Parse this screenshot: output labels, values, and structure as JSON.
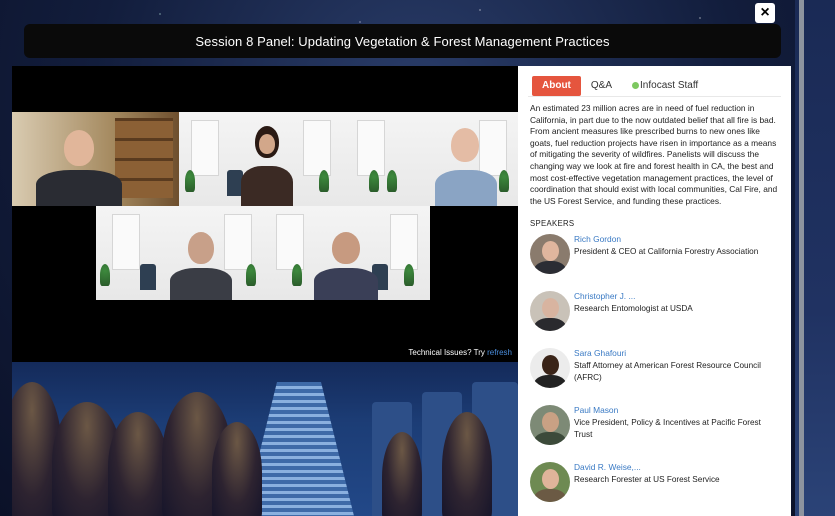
{
  "session": {
    "title": "Session 8 Panel: Updating Vegetation & Forest Management Practices"
  },
  "controls": {
    "close_glyph": "×"
  },
  "video": {
    "tech_issue_text": "Technical Issues? Try",
    "refresh_label": "refresh"
  },
  "panel": {
    "tabs": [
      {
        "label": "About"
      },
      {
        "label": "Q&A"
      },
      {
        "label": "Infocast Staff"
      }
    ],
    "description": "An estimated 23 million acres are in need of fuel reduction in California, in part due to the now outdated belief that all fire is bad. From ancient measures like prescribed burns to new ones like goats, fuel reduction projects have risen in importance as a means of mitigating the severity of wildfires. Panelists will discuss the changing way we look at fire and forest health in CA, the best and most cost-effective vegetation management practices, the level of coordination that should exist with local communities, Cal Fire, and the US Forest Service, and funding these practices.",
    "speakers_heading": "SPEAKERS",
    "speakers": [
      {
        "name": "Rich Gordon",
        "role": "President & CEO at California Forestry Association"
      },
      {
        "name": "Christopher J. ...",
        "role": "Research Entomologist at USDA"
      },
      {
        "name": "Sara Ghafouri",
        "role": "Staff Attorney at American Forest Resource Council (AFRC)"
      },
      {
        "name": "Paul Mason",
        "role": "Vice President, Policy & Incentives at Pacific Forest Trust"
      },
      {
        "name": "David R. Weise,...",
        "role": "Research Forester at US Forest Service"
      }
    ]
  },
  "colors": {
    "active_tab": "#e5553e",
    "link": "#3a7ac4",
    "online_dot": "#7dc860"
  }
}
